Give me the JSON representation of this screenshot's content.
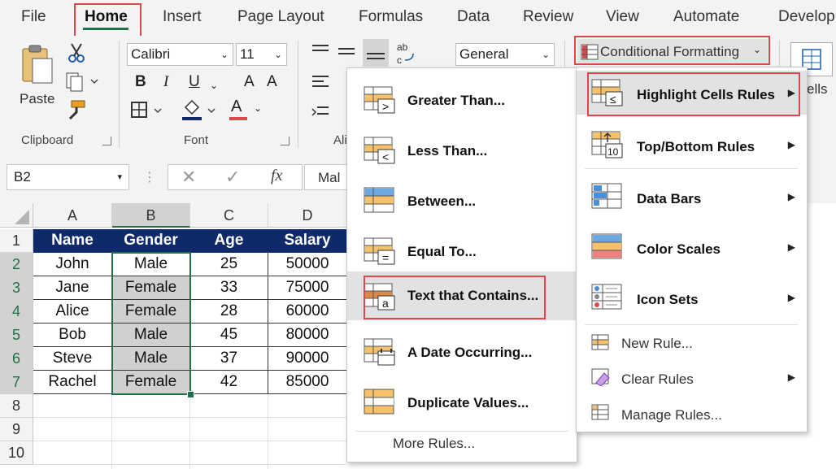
{
  "tabs": [
    "File",
    "Home",
    "Insert",
    "Page Layout",
    "Formulas",
    "Data",
    "Review",
    "View",
    "Automate",
    "Develop"
  ],
  "ribbon": {
    "paste_label": "Paste",
    "clipboard_label": "Clipboard",
    "font_name": "Calibri",
    "font_size": "11",
    "font_label": "Font",
    "align_label_partial": "Ali",
    "number_format": "General",
    "bold": "B",
    "italic": "I",
    "underline": "U",
    "grow_font": "A",
    "shrink_font": "A",
    "font_color": "A",
    "conditional_formatting": "Conditional Formatting",
    "cells_partial": "ells"
  },
  "formula_bar": {
    "name_box": "B2",
    "fx": "fx",
    "content_partial": "Mal"
  },
  "grid": {
    "columns": [
      "A",
      "B",
      "C",
      "D"
    ],
    "rows": [
      "1",
      "2",
      "3",
      "4",
      "5",
      "6",
      "7",
      "8",
      "9",
      "10"
    ],
    "header": [
      "Name",
      "Gender",
      "Age",
      "Salary"
    ],
    "data": [
      [
        "John",
        "Male",
        "25",
        "50000"
      ],
      [
        "Jane",
        "Female",
        "33",
        "75000"
      ],
      [
        "Alice",
        "Female",
        "28",
        "60000"
      ],
      [
        "Bob",
        "Male",
        "45",
        "80000"
      ],
      [
        "Steve",
        "Male",
        "37",
        "90000"
      ],
      [
        "Rachel",
        "Female",
        "42",
        "85000"
      ]
    ]
  },
  "cf_menu": {
    "items": [
      {
        "label": "Highlight Cells Rules",
        "icon": "highlight-cells-icon"
      },
      {
        "label": "Top/Bottom Rules",
        "icon": "top-bottom-icon"
      },
      {
        "label": "Data Bars",
        "icon": "data-bars-icon"
      },
      {
        "label": "Color Scales",
        "icon": "color-scales-icon"
      },
      {
        "label": "Icon Sets",
        "icon": "icon-sets-icon"
      },
      {
        "label": "New Rule...",
        "icon": "new-rule-icon"
      },
      {
        "label": "Clear Rules",
        "icon": "clear-rules-icon"
      },
      {
        "label": "Manage Rules...",
        "icon": "manage-rules-icon"
      }
    ]
  },
  "hc_menu": {
    "items": [
      {
        "label": "Greater Than...",
        "symbol": ">"
      },
      {
        "label": "Less Than...",
        "symbol": "<"
      },
      {
        "label": "Between...",
        "symbol": ""
      },
      {
        "label": "Equal To...",
        "symbol": "="
      },
      {
        "label": "Text that Contains...",
        "symbol": "a"
      },
      {
        "label": "A Date Occurring...",
        "symbol": ""
      },
      {
        "label": "Duplicate Values...",
        "symbol": ""
      },
      {
        "label": "More Rules...",
        "symbol": ""
      }
    ]
  },
  "colors": {
    "accent_green": "#1e7145",
    "header_fill": "#0f2a6b",
    "highlight_red": "#e0474c",
    "icon_orange": "#f0a030",
    "icon_blue": "#4a90d9"
  }
}
